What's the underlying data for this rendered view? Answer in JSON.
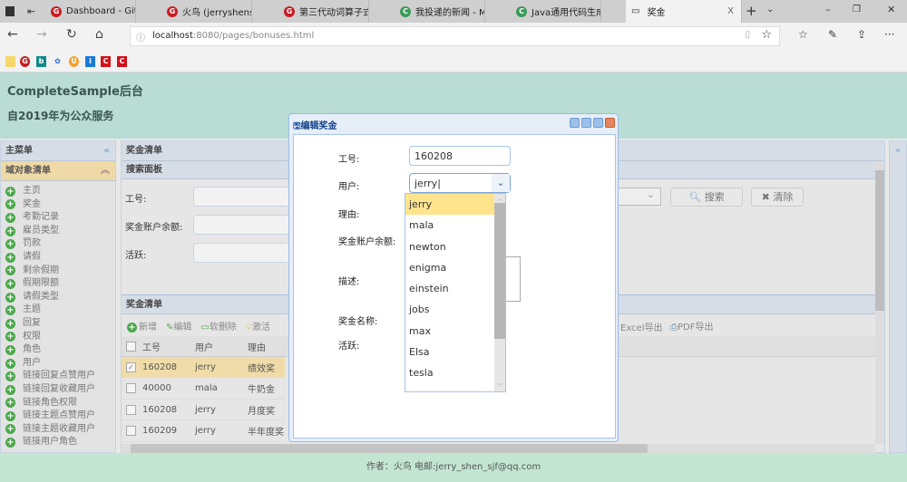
{
  "browser": {
    "tabs": [
      {
        "label": "Dashboard - Gitee",
        "icon": "gitee-icon"
      },
      {
        "label": "火鸟 (jerryshensjf) - Git",
        "icon": "gitee-icon"
      },
      {
        "label": "第三代动词算子式代码",
        "icon": "gitee-icon"
      },
      {
        "label": "我投递的新闻 - MS&A(",
        "icon": "c-green-icon"
      },
      {
        "label": "Java通用代码生成器光",
        "icon": "c-green-icon"
      },
      {
        "label": "奖金",
        "icon": "page-icon",
        "active": true
      }
    ],
    "close_tab": "X",
    "new_tab": "+",
    "url_host": "localhost",
    "url_rest": ":8080/pages/bonuses.html",
    "more": "···",
    "bookmarks": [
      "folder",
      "gitee",
      "bing",
      "baidu",
      "u",
      "i",
      "c",
      "c"
    ]
  },
  "header": {
    "title": "CompleteSample后台",
    "subtitle": "自2019年为公众服务"
  },
  "sidebar": {
    "title": "主菜单",
    "section": "域对象清单",
    "items": [
      "主页",
      "奖金",
      "考勤记录",
      "雇员类型",
      "罚款",
      "请假",
      "剩余假期",
      "假期限额",
      "请假类型",
      "主题",
      "回复",
      "权限",
      "角色",
      "用户",
      "链接回复点赞用户",
      "链接回复收藏用户",
      "链接角色权限",
      "链接主题点赞用户",
      "链接主题收藏用户",
      "链接用户角色"
    ]
  },
  "main": {
    "title": "奖金清单",
    "search": {
      "title": "搜索面板",
      "fields": [
        "工号:",
        "奖金账户余额:",
        "活跃:"
      ],
      "search_btn": "搜索",
      "clear_btn": "清除"
    },
    "grid": {
      "title": "奖金清单",
      "toolbar": [
        "新增",
        "编辑",
        "软删除",
        "激活"
      ],
      "export_excel": "Excel导出",
      "export_pdf": "PDF导出",
      "columns": [
        "工号",
        "用户",
        "理由"
      ],
      "rows": [
        {
          "id": "160208",
          "user": "jerry",
          "reason": "绩效奖",
          "selected": true
        },
        {
          "id": "40000",
          "user": "mala",
          "reason": "牛奶金"
        },
        {
          "id": "160208",
          "user": "jerry",
          "reason": "月度奖"
        },
        {
          "id": "160209",
          "user": "jerry",
          "reason": "半年度奖"
        }
      ]
    }
  },
  "dialog": {
    "title": "编辑奖金",
    "labels": {
      "id": "工号:",
      "user": "用户:",
      "reason": "理由:",
      "balance": "奖金账户余额:",
      "desc": "描述:",
      "name": "奖金名称:",
      "active": "活跃:"
    },
    "id_value": "160208",
    "user_value": "jerry",
    "user_options": [
      "jerry",
      "mala",
      "newton",
      "enigma",
      "einstein",
      "jobs",
      "max",
      "Elsa",
      "tesla"
    ],
    "highlighted_option": "jerry"
  },
  "footer": {
    "text": "作者：火鸟 电邮:jerry_shen_sjf@qq.com"
  },
  "colors": {
    "header": "#b9dcd4",
    "footer": "#c3e6d3",
    "selected_row": "#f0dca8",
    "dropdown_highlight": "#ffe48d"
  }
}
